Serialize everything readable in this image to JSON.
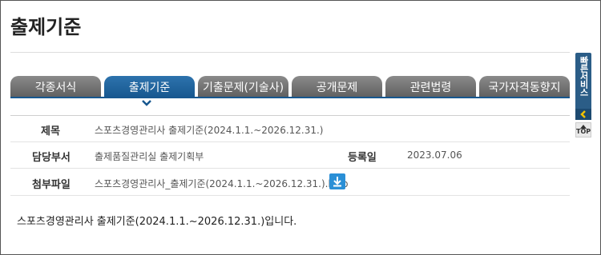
{
  "page": {
    "title": "출제기준"
  },
  "tabs": [
    {
      "label": "각종서식",
      "active": false
    },
    {
      "label": "출제기준",
      "active": true
    },
    {
      "label": "기출문제(기술사)",
      "active": false
    },
    {
      "label": "공개문제",
      "active": false
    },
    {
      "label": "관련법령",
      "active": false
    },
    {
      "label": "국가자격동향지",
      "active": false
    }
  ],
  "info": {
    "subject_label": "제목",
    "subject_value": "스포츠경영관리사 출제기준(2024.1.1.~2026.12.31.)",
    "dept_label": "담당부서",
    "dept_value": "출제품질관리실 출제기획부",
    "date_label": "등록일",
    "date_value": "2023.07.06",
    "file_label": "첨부파일",
    "file_value": "스포츠경영관리사_출제기준(2024.1.1.~2026.12.31.).hwp"
  },
  "body": {
    "text": "스포츠경영관리사 출제기준(2024.1.1.~2026.12.31.)입니다."
  },
  "quick_menu": {
    "label": "빠른서비스",
    "top_label": "TOP"
  },
  "icons": {
    "download": "download-icon",
    "chevron": "chevron-down-icon",
    "collapse": "chevron-left-icon",
    "top": "arrow-up-icon"
  },
  "colors": {
    "active_tab": "#17578f",
    "inactive_tab": "#6e6e6e",
    "download_button": "#2a8fd6",
    "quick_menu": "#2b5d87",
    "collapse_arrow": "#f2c200"
  }
}
